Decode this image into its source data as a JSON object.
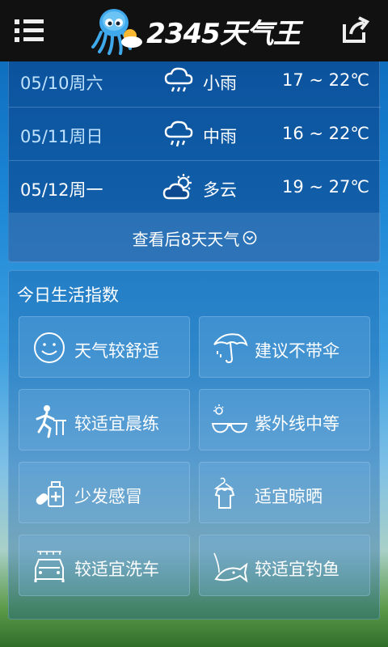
{
  "app": {
    "brand": "2345天气王",
    "icons": {
      "menu": "menu-icon",
      "share": "share-icon",
      "logo": "octopus-logo-icon"
    }
  },
  "forecast": {
    "days": [
      {
        "date": "05/10周六",
        "icon": "rain-cloud-icon",
        "condition": "小雨",
        "temp": "17 ~ 22℃"
      },
      {
        "date": "05/11周日",
        "icon": "rain-cloud-icon",
        "condition": "中雨",
        "temp": "16 ~ 22℃"
      },
      {
        "date": "05/12周一",
        "icon": "partly-cloudy-icon",
        "condition": "多云",
        "temp": "19 ~ 27℃"
      }
    ],
    "more_label": "查看后8天天气"
  },
  "life_index": {
    "title": "今日生活指数",
    "items": [
      {
        "label": "天气较舒适",
        "icon": "smiley-icon"
      },
      {
        "label": "建议不带伞",
        "icon": "umbrella-icon"
      },
      {
        "label": "较适宜晨练",
        "icon": "running-person-icon"
      },
      {
        "label": "紫外线中等",
        "icon": "sunglasses-icon"
      },
      {
        "label": "少发感冒",
        "icon": "medicine-icon"
      },
      {
        "label": "适宜晾晒",
        "icon": "shirt-hanger-icon"
      },
      {
        "label": "较适宜洗车",
        "icon": "car-wash-icon"
      },
      {
        "label": "较适宜钓鱼",
        "icon": "fishing-icon"
      }
    ]
  }
}
